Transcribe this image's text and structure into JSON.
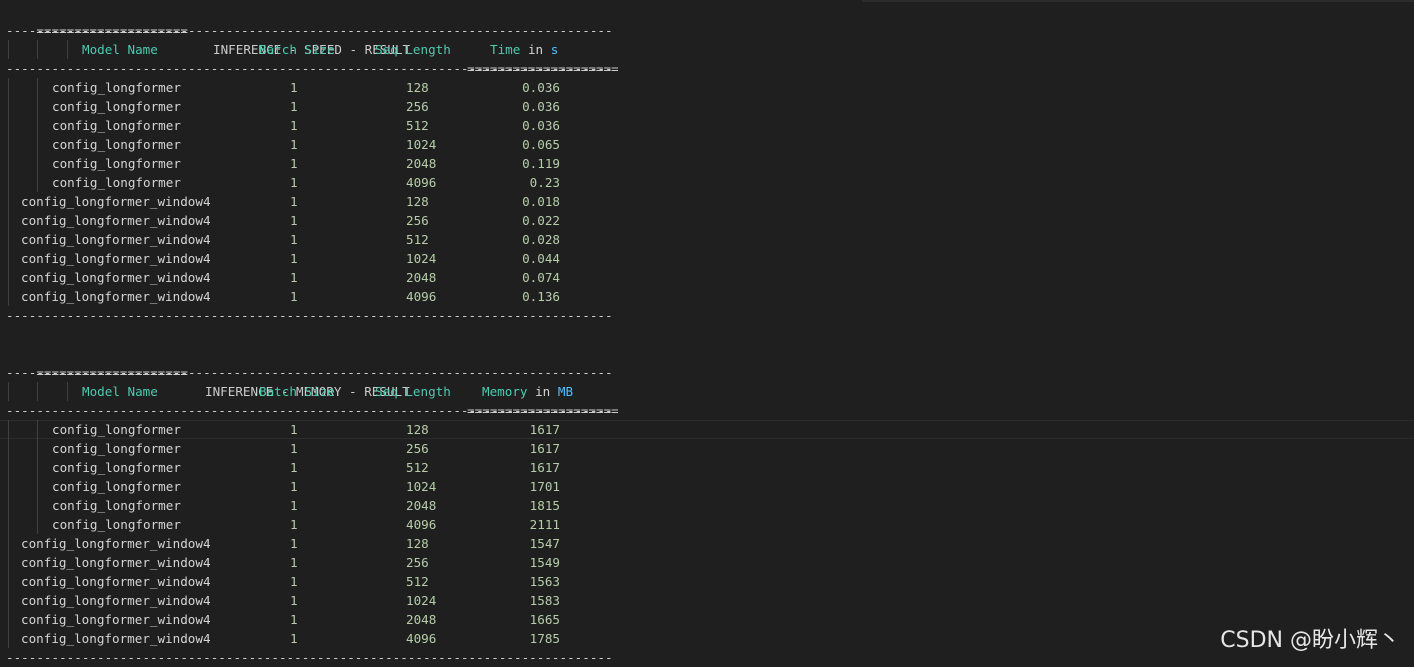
{
  "speed": {
    "banner_left": "====================",
    "banner_title": "INFERENCE - SPEED - RESULT",
    "banner_right": "====================",
    "header": {
      "model_name": "Model Name",
      "batch_size": "Batch Size",
      "seq_length": "Seq Length",
      "metric_label": "Time",
      "in": "in",
      "unit": "s"
    },
    "rows": [
      {
        "model": "config_longformer",
        "batch": "1",
        "seq": "128",
        "value": "0.036"
      },
      {
        "model": "config_longformer",
        "batch": "1",
        "seq": "256",
        "value": "0.036"
      },
      {
        "model": "config_longformer",
        "batch": "1",
        "seq": "512",
        "value": "0.036"
      },
      {
        "model": "config_longformer",
        "batch": "1",
        "seq": "1024",
        "value": "0.065"
      },
      {
        "model": "config_longformer",
        "batch": "1",
        "seq": "2048",
        "value": "0.119"
      },
      {
        "model": "config_longformer",
        "batch": "1",
        "seq": "4096",
        "value": "0.23"
      },
      {
        "model": "config_longformer_window4",
        "batch": "1",
        "seq": "128",
        "value": "0.018"
      },
      {
        "model": "config_longformer_window4",
        "batch": "1",
        "seq": "256",
        "value": "0.022"
      },
      {
        "model": "config_longformer_window4",
        "batch": "1",
        "seq": "512",
        "value": "0.028"
      },
      {
        "model": "config_longformer_window4",
        "batch": "1",
        "seq": "1024",
        "value": "0.044"
      },
      {
        "model": "config_longformer_window4",
        "batch": "1",
        "seq": "2048",
        "value": "0.074"
      },
      {
        "model": "config_longformer_window4",
        "batch": "1",
        "seq": "4096",
        "value": "0.136"
      }
    ]
  },
  "memory": {
    "banner_left": "====================",
    "banner_title": "INFERENCE - MEMORY - RESULT",
    "banner_right": "====================",
    "header": {
      "model_name": "Model Name",
      "batch_size": "Batch Size",
      "seq_length": "Seq Length",
      "metric_label": "Memory",
      "in": "in",
      "unit": "MB"
    },
    "rows": [
      {
        "model": "config_longformer",
        "batch": "1",
        "seq": "128",
        "value": "1617"
      },
      {
        "model": "config_longformer",
        "batch": "1",
        "seq": "256",
        "value": "1617"
      },
      {
        "model": "config_longformer",
        "batch": "1",
        "seq": "512",
        "value": "1617"
      },
      {
        "model": "config_longformer",
        "batch": "1",
        "seq": "1024",
        "value": "1701"
      },
      {
        "model": "config_longformer",
        "batch": "1",
        "seq": "2048",
        "value": "1815"
      },
      {
        "model": "config_longformer",
        "batch": "1",
        "seq": "4096",
        "value": "2111"
      },
      {
        "model": "config_longformer_window4",
        "batch": "1",
        "seq": "128",
        "value": "1547"
      },
      {
        "model": "config_longformer_window4",
        "batch": "1",
        "seq": "256",
        "value": "1549"
      },
      {
        "model": "config_longformer_window4",
        "batch": "1",
        "seq": "512",
        "value": "1563"
      },
      {
        "model": "config_longformer_window4",
        "batch": "1",
        "seq": "1024",
        "value": "1583"
      },
      {
        "model": "config_longformer_window4",
        "batch": "1",
        "seq": "2048",
        "value": "1665"
      },
      {
        "model": "config_longformer_window4",
        "batch": "1",
        "seq": "4096",
        "value": "1785"
      }
    ]
  },
  "watermark": "CSDN @盼小辉丶",
  "colors": {
    "background": "#1f1f1f",
    "header_teal": "#4ec9b0",
    "number_green": "#b5cea8",
    "unit_blue": "#4fc1ff",
    "text": "#d4d4d4"
  }
}
